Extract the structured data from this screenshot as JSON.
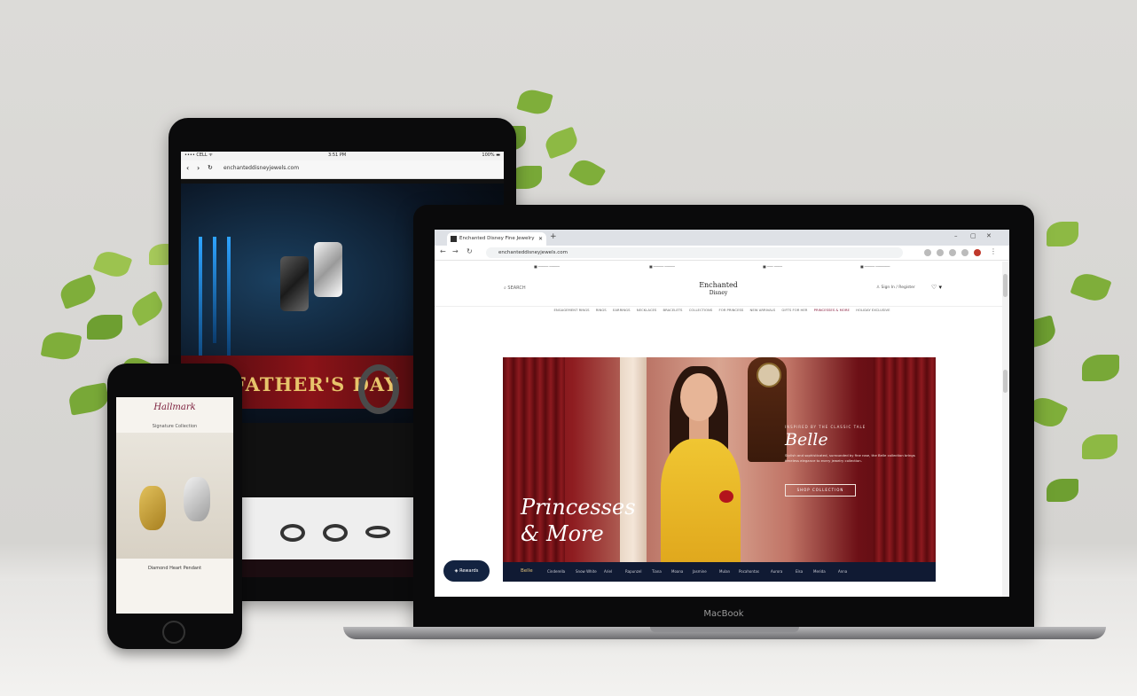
{
  "tablet": {
    "status_carrier": "•••• CELL ᯤ",
    "status_time": "3:51 PM",
    "status_battery": "100% ▬",
    "url": "enchanteddisneyjewels.com",
    "hero_title": "FATHER'S DAY"
  },
  "phone": {
    "logo": "Hallmark",
    "tagline": "Signature Collection",
    "caption": "Diamond Heart Pendant"
  },
  "laptop": {
    "brand": "MacBook",
    "tab_title": "Enchanted Disney Fine Jewelry",
    "url": "enchanteddisneyjewels.com",
    "search_label": "SEARCH",
    "logo_line1": "Enchanted",
    "logo_line2": "Disney",
    "signin_label": "Sign In / Register",
    "menu": [
      "ENGAGEMENT RINGS",
      "RINGS",
      "EARRINGS",
      "NECKLACES",
      "BRACELETS",
      "COLLECTIONS",
      "FOR PRINCESS",
      "NEW ARRIVALS",
      "GIFTS FOR HER",
      "PRINCESSES & MORE",
      "HOLIDAY EXCLUSIVE"
    ],
    "menu_active_index": 9,
    "banner": {
      "headline_line1": "Princesses",
      "headline_line2": "& More",
      "kicker": "INSPIRED BY THE CLASSIC TALE",
      "title": "Belle",
      "body": "Stylish and sophisticated, surrounded by fine rose, the Belle collection brings timeless elegance to every jewelry collection.",
      "cta": "SHOP COLLECTION"
    },
    "subnav": [
      "Belle",
      "Cinderella",
      "Snow White",
      "Ariel",
      "Rapunzel",
      "Tiana",
      "Moana",
      "Jasmine",
      "Mulan",
      "Pocahontas",
      "Aurora",
      "Elsa",
      "Merida",
      "Anna"
    ],
    "rewards_label": "Rewards"
  },
  "colors": {
    "accent_gold": "#e7c46b",
    "navy": "#101a33",
    "wine": "#8e1c20"
  }
}
